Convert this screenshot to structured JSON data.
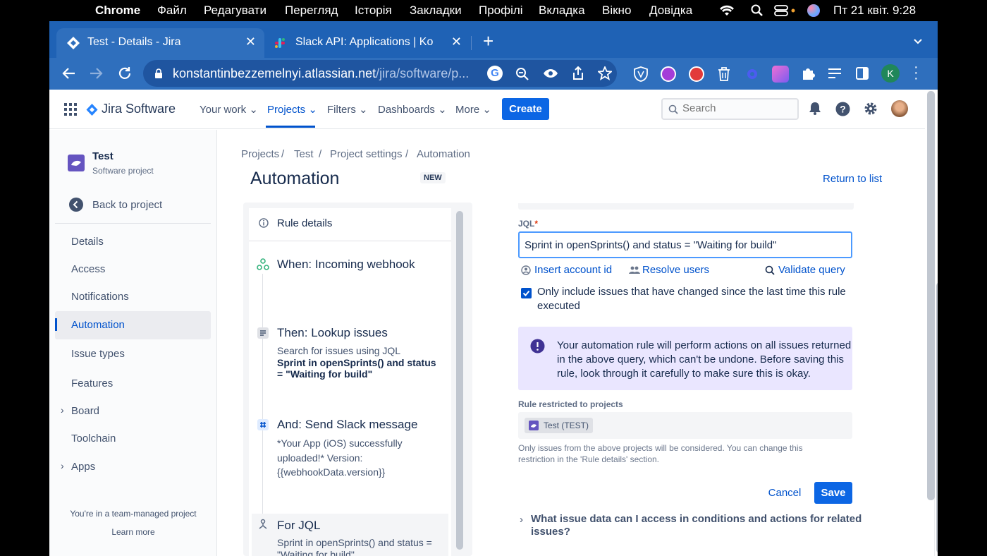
{
  "macbar": {
    "app": "Chrome",
    "menus": [
      "Файл",
      "Редагувати",
      "Перегляд",
      "Історія",
      "Закладки",
      "Профілі",
      "Вкладка",
      "Вікно",
      "Довідка"
    ],
    "datetime": "Пт 21 квіт.  9:28"
  },
  "browser": {
    "tabs": [
      {
        "title": "Test - Details - Jira"
      },
      {
        "title": "Slack API: Applications | Konsta"
      }
    ],
    "url_main": "konstantinbezzemelnyi.atlassian.net",
    "url_path": "/jira/software/p...",
    "profile_initial": "K"
  },
  "jira": {
    "product": "Jira Software",
    "nav": {
      "your_work": "Your work",
      "projects": "Projects",
      "filters": "Filters",
      "dashboards": "Dashboards",
      "more": "More",
      "create": "Create",
      "search_placeholder": "Search"
    },
    "sidebar": {
      "project_name": "Test",
      "project_type": "Software project",
      "back": "Back to project",
      "items": [
        "Details",
        "Access",
        "Notifications",
        "Automation",
        "Issue types",
        "Features",
        "Board",
        "Toolchain",
        "Apps"
      ],
      "footer": "You're in a team-managed project",
      "learn_more": "Learn more"
    },
    "breadcrumb": [
      "Projects",
      "Test",
      "Project settings",
      "Automation"
    ],
    "page_title": "Automation",
    "badge": "NEW",
    "return_link": "Return to list",
    "rule": {
      "details": "Rule details",
      "components": [
        {
          "title": "When: Incoming webhook"
        },
        {
          "title": "Then: Lookup issues",
          "desc": "Search for issues using JQL",
          "bold1": "Sprint in openSprints() and status",
          "bold2": "= \"Waiting for build\""
        },
        {
          "title": "And: Send Slack message",
          "l1": "*Your App (iOS) successfully",
          "l2": "uploaded!* Version:",
          "l3": "{{webhookData.version}}"
        },
        {
          "title": "For JQL",
          "l1": "Sprint in openSprints() and status =",
          "l2": "\"Waiting for build\""
        }
      ]
    },
    "form": {
      "jql_label": "JQL",
      "jql_value": "Sprint in openSprints() and status = \"Waiting for build\"",
      "insert_account": "Insert account id",
      "resolve_users": "Resolve users",
      "validate": "Validate query",
      "checkbox_l1": "Only include issues that have changed since the last time this rule",
      "checkbox_l2": "executed",
      "warn_l1": "Your automation rule will perform actions on all issues returned",
      "warn_l2": "in the above query, which can't be undone. Before saving this",
      "warn_l3": "rule, look through it carefully to make sure this is okay.",
      "restricted_label": "Rule restricted to projects",
      "project_chip": "Test (TEST)",
      "help_l1": "Only issues from the above projects will be considered. You can change this",
      "help_l2": "restriction in the 'Rule details' section.",
      "cancel": "Cancel",
      "save": "Save",
      "faq_l1": "What issue data can I access in conditions and actions for related",
      "faq_l2": "issues?"
    }
  }
}
